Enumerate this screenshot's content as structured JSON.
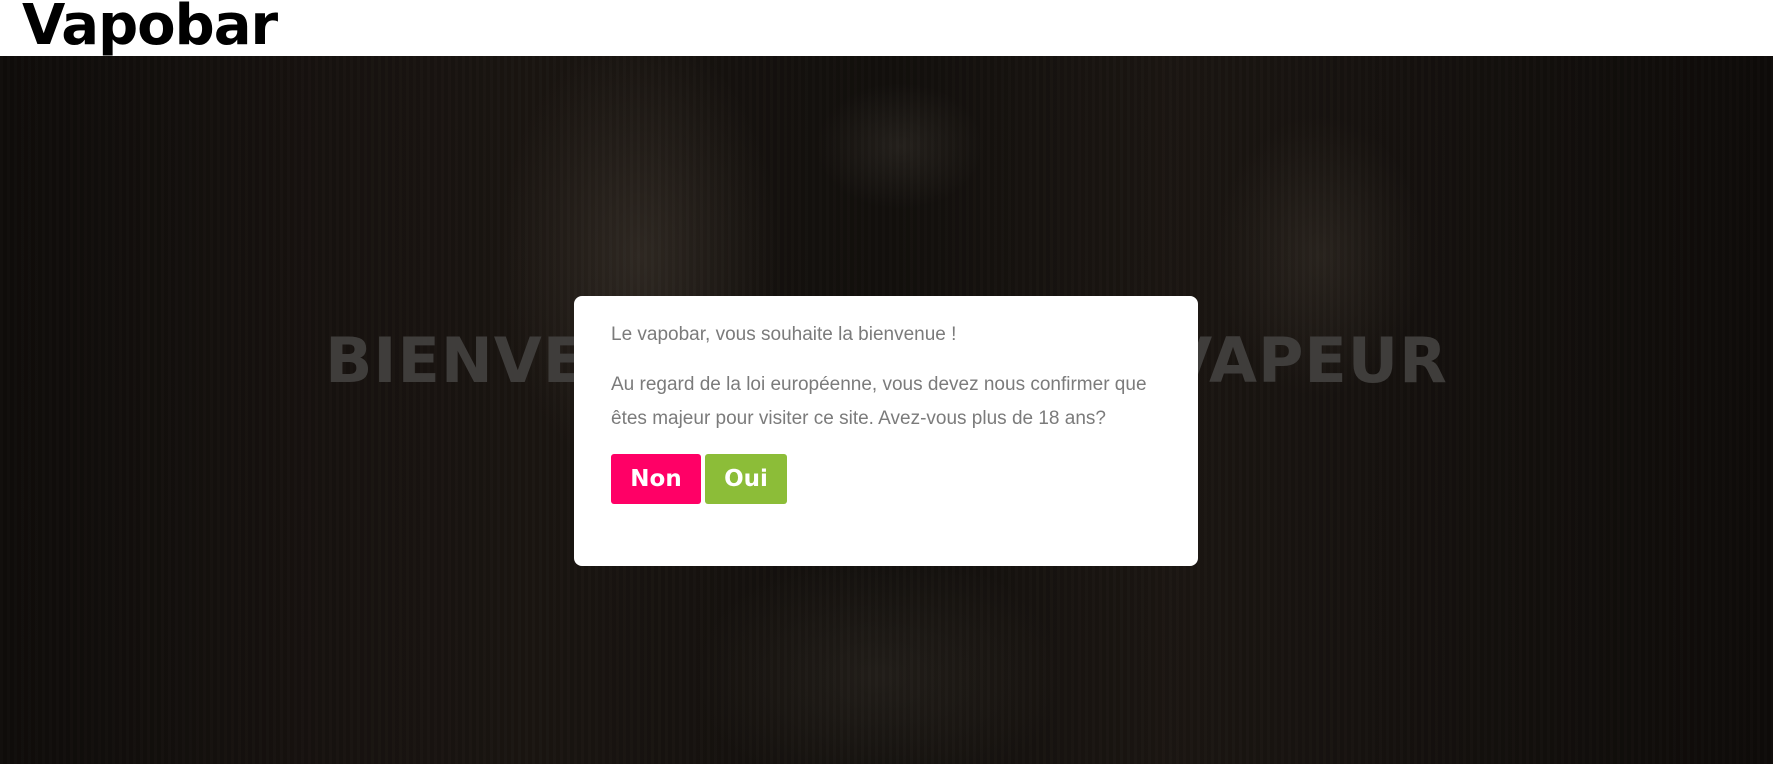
{
  "header": {
    "logo_text": "Vapobar"
  },
  "hero": {
    "title": "BIENVENUE AU BAR DE VAPEUR"
  },
  "age_gate": {
    "welcome": "Le vapobar, vous souhaite la bienvenue !",
    "message": "Au regard de la loi européenne, vous devez nous confirmer que êtes majeur pour visiter ce site. Avez-vous plus de 18 ans?",
    "no_label": "Non",
    "yes_label": "Oui"
  },
  "colors": {
    "no_button": "#ff0066",
    "yes_button": "#8cbd38",
    "overlay": "#15110e"
  }
}
